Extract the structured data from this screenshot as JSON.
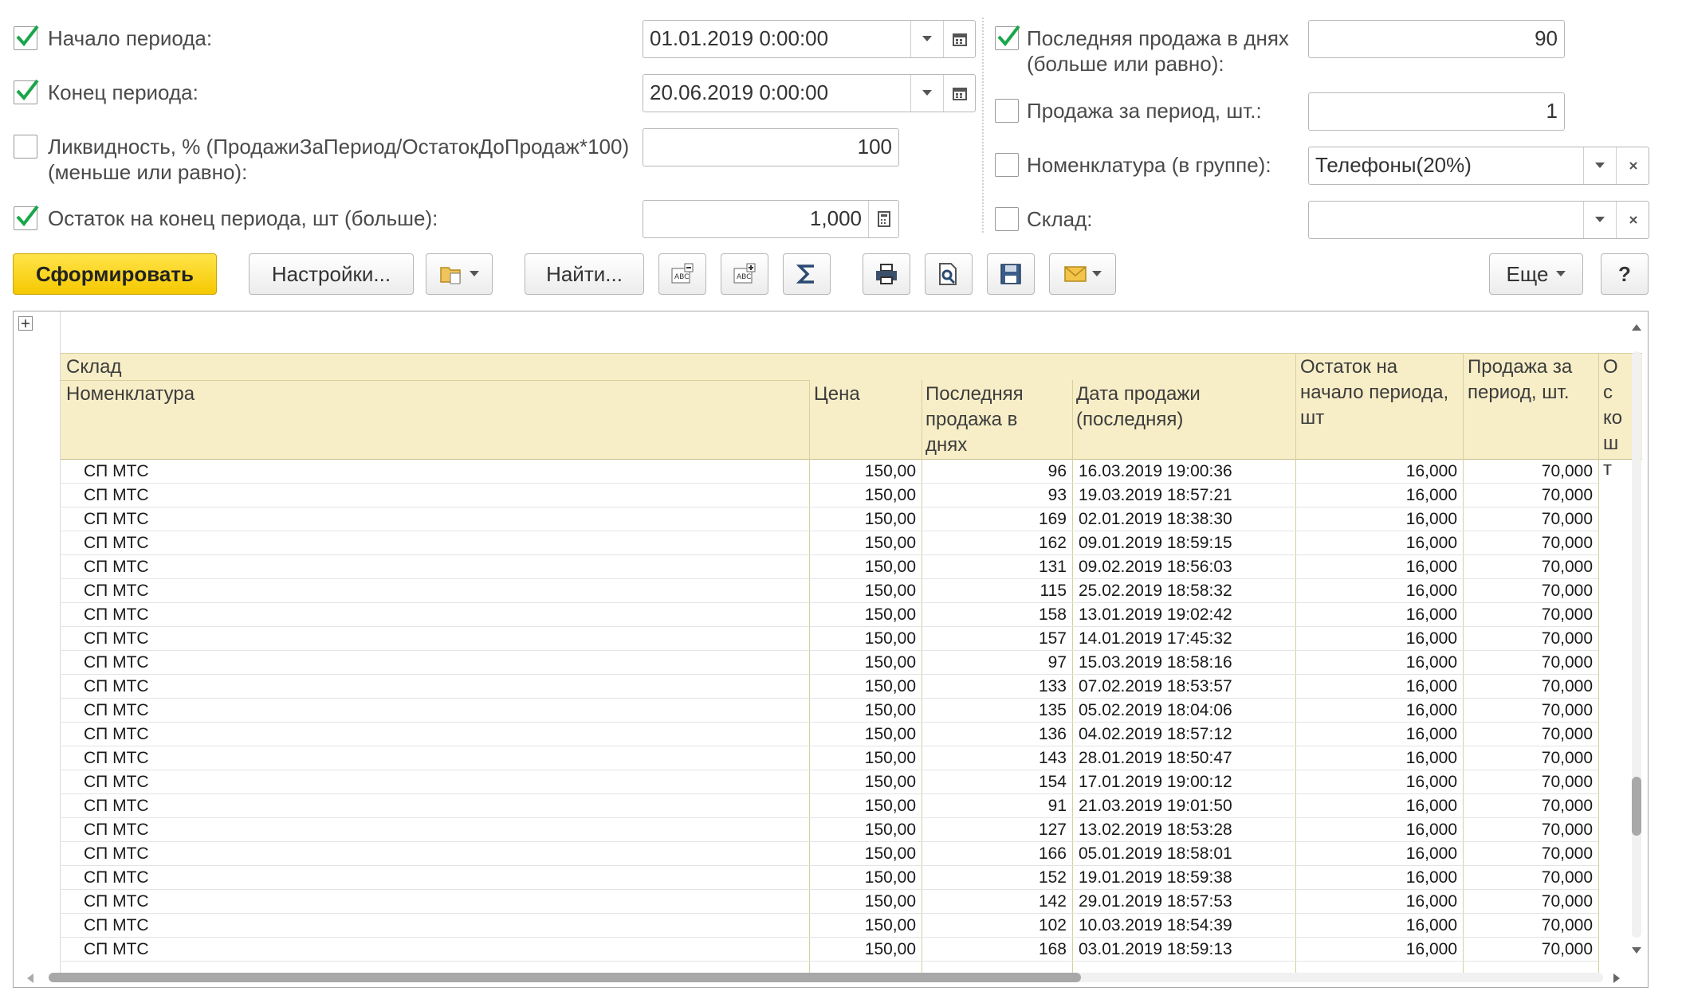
{
  "filters": {
    "period_start": {
      "label": "Начало периода:",
      "checked": true,
      "value": "01.01.2019  0:00:00"
    },
    "period_end": {
      "label": "Конец периода:",
      "checked": true,
      "value": "20.06.2019  0:00:00"
    },
    "liquidity": {
      "label_line1": "Ликвидность, % (ПродажиЗаПериод/ОстатокДоПродаж*100)",
      "label_line2": "(меньше или равно):",
      "checked": false,
      "value": "100"
    },
    "stock_end": {
      "label": "Остаток на конец периода, шт (больше):",
      "checked": true,
      "value": "1,000"
    },
    "last_sale_days": {
      "label_line1": "Последняя продажа в днях",
      "label_line2": "(больше или равно):",
      "checked": true,
      "value": "90"
    },
    "sales_period": {
      "label": "Продажа за период, шт.:",
      "checked": false,
      "value": "1"
    },
    "nomenclature": {
      "label": "Номенклатура (в группе):",
      "checked": false,
      "value": "Телефоны(20%)"
    },
    "warehouse": {
      "label": "Склад:",
      "checked": false,
      "value": ""
    }
  },
  "toolbar": {
    "generate": "Сформировать",
    "settings": "Настройки...",
    "find": "Найти...",
    "more": "Еще",
    "help": "?"
  },
  "table": {
    "headers": {
      "warehouse": "Склад",
      "nomenclature": "Номенклатура",
      "price": "Цена",
      "last_sale_days": "Последняя продажа в днях",
      "sale_date": "Дата продажи (последняя)",
      "start_balance": "Остаток на начало периода, шт",
      "period_sales": "Продажа за период, шт.",
      "end_balance_cut": "Ос ко шт"
    },
    "rows": [
      {
        "name": "СП МТС",
        "price": "150,00",
        "days": "96",
        "date": "16.03.2019 19:00:36",
        "start": "16,000",
        "sales": "70,000"
      },
      {
        "name": "СП МТС",
        "price": "150,00",
        "days": "93",
        "date": "19.03.2019 18:57:21",
        "start": "16,000",
        "sales": "70,000"
      },
      {
        "name": "СП МТС",
        "price": "150,00",
        "days": "169",
        "date": "02.01.2019 18:38:30",
        "start": "16,000",
        "sales": "70,000"
      },
      {
        "name": "СП МТС",
        "price": "150,00",
        "days": "162",
        "date": "09.01.2019 18:59:15",
        "start": "16,000",
        "sales": "70,000"
      },
      {
        "name": "СП МТС",
        "price": "150,00",
        "days": "131",
        "date": "09.02.2019 18:56:03",
        "start": "16,000",
        "sales": "70,000"
      },
      {
        "name": "СП МТС",
        "price": "150,00",
        "days": "115",
        "date": "25.02.2019 18:58:32",
        "start": "16,000",
        "sales": "70,000"
      },
      {
        "name": "СП МТС",
        "price": "150,00",
        "days": "158",
        "date": "13.01.2019 19:02:42",
        "start": "16,000",
        "sales": "70,000"
      },
      {
        "name": "СП МТС",
        "price": "150,00",
        "days": "157",
        "date": "14.01.2019 17:45:32",
        "start": "16,000",
        "sales": "70,000"
      },
      {
        "name": "СП МТС",
        "price": "150,00",
        "days": "97",
        "date": "15.03.2019 18:58:16",
        "start": "16,000",
        "sales": "70,000"
      },
      {
        "name": "СП МТС",
        "price": "150,00",
        "days": "133",
        "date": "07.02.2019 18:53:57",
        "start": "16,000",
        "sales": "70,000"
      },
      {
        "name": "СП МТС",
        "price": "150,00",
        "days": "135",
        "date": "05.02.2019 18:04:06",
        "start": "16,000",
        "sales": "70,000"
      },
      {
        "name": "СП МТС",
        "price": "150,00",
        "days": "136",
        "date": "04.02.2019 18:57:12",
        "start": "16,000",
        "sales": "70,000"
      },
      {
        "name": "СП МТС",
        "price": "150,00",
        "days": "143",
        "date": "28.01.2019 18:50:47",
        "start": "16,000",
        "sales": "70,000"
      },
      {
        "name": "СП МТС",
        "price": "150,00",
        "days": "154",
        "date": "17.01.2019 19:00:12",
        "start": "16,000",
        "sales": "70,000"
      },
      {
        "name": "СП МТС",
        "price": "150,00",
        "days": "91",
        "date": "21.03.2019 19:01:50",
        "start": "16,000",
        "sales": "70,000"
      },
      {
        "name": "СП МТС",
        "price": "150,00",
        "days": "127",
        "date": "13.02.2019 18:53:28",
        "start": "16,000",
        "sales": "70,000"
      },
      {
        "name": "СП МТС",
        "price": "150,00",
        "days": "166",
        "date": "05.01.2019 18:58:01",
        "start": "16,000",
        "sales": "70,000"
      },
      {
        "name": "СП МТС",
        "price": "150,00",
        "days": "152",
        "date": "19.01.2019 18:59:38",
        "start": "16,000",
        "sales": "70,000"
      },
      {
        "name": "СП МТС",
        "price": "150,00",
        "days": "142",
        "date": "29.01.2019 18:57:53",
        "start": "16,000",
        "sales": "70,000"
      },
      {
        "name": "СП МТС",
        "price": "150,00",
        "days": "102",
        "date": "10.03.2019 18:54:39",
        "start": "16,000",
        "sales": "70,000"
      },
      {
        "name": "СП МТС",
        "price": "150,00",
        "days": "168",
        "date": "03.01.2019 18:59:13",
        "start": "16,000",
        "sales": "70,000"
      }
    ]
  },
  "icons": [
    "calendar-icon",
    "dropdown-arrow-icon",
    "clear-icon",
    "checkmark-icon",
    "expand-icon",
    "variant-icon",
    "collapse-groups-icon",
    "expand-groups-icon",
    "sum-icon",
    "print-icon",
    "preview-icon",
    "save-icon",
    "mail-icon",
    "scroll-up-icon",
    "scroll-down-icon",
    "scroll-left-icon",
    "scroll-right-icon"
  ]
}
